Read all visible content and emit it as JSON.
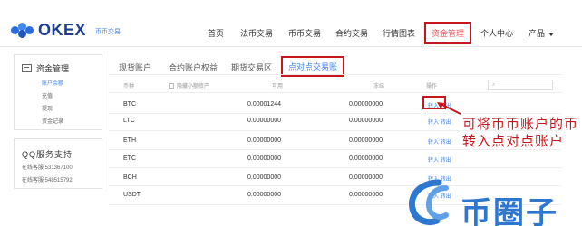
{
  "header": {
    "logo_text": "OKEX",
    "logo_sub": "币币交易",
    "nav": [
      {
        "label": "首页"
      },
      {
        "label": "法币交易"
      },
      {
        "label": "币币交易"
      },
      {
        "label": "合约交易"
      },
      {
        "label": "行情图表"
      },
      {
        "label": "资金管理"
      },
      {
        "label": "个人中心"
      },
      {
        "label": "产品"
      }
    ],
    "active_nav": "资金管理"
  },
  "sidebar": {
    "title": "资金管理",
    "items": [
      {
        "label": "账户余额",
        "active": true
      },
      {
        "label": "充值"
      },
      {
        "label": "提现"
      },
      {
        "label": "资金记录"
      }
    ],
    "qq": {
      "title": "QQ服务支持",
      "lines": [
        "在线客服 531367100",
        "在线客服 548515792"
      ]
    }
  },
  "tabs": [
    {
      "label": "现货账户"
    },
    {
      "label": "合约账户权益"
    },
    {
      "label": "期货交易区"
    },
    {
      "label": "点对点交易账"
    }
  ],
  "active_tab": "点对点交易账",
  "table": {
    "headers": {
      "currency": "币种",
      "hide_small": "隐藏小额资产",
      "available": "可用",
      "frozen": "冻结",
      "ops": "操作"
    },
    "rows": [
      {
        "currency": "BTC",
        "available": "0.00001244",
        "frozen": "0.00000000",
        "ops": [
          "转入",
          "转出"
        ]
      },
      {
        "currency": "LTC",
        "available": "0.00000000",
        "frozen": "0.00000000",
        "ops": [
          "转入",
          "转出"
        ]
      },
      {
        "currency": "ETH",
        "available": "0.00000000",
        "frozen": "0.00000000",
        "ops": [
          "转入",
          "转出"
        ]
      },
      {
        "currency": "ETC",
        "available": "0.00000000",
        "frozen": "0.00000000",
        "ops": [
          "转入",
          "转出"
        ]
      },
      {
        "currency": "BCH",
        "available": "0.00000000",
        "frozen": "0.00000000",
        "ops": [
          "转入",
          "转出"
        ]
      },
      {
        "currency": "USDT",
        "available": "0.00000000",
        "frozen": "0.00000000",
        "ops": [
          "转入",
          "转出"
        ]
      }
    ]
  },
  "annotation": "可将币币账户的币转入点对点账户",
  "watermark": "币圈子",
  "colors": {
    "accent": "#3f86f0",
    "highlight": "#c8161d",
    "brand": "#1c3f8c"
  }
}
